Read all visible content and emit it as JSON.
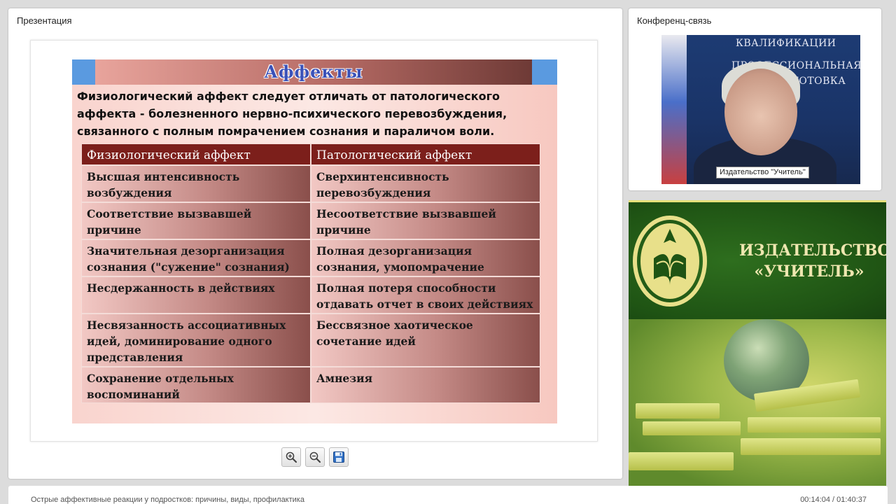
{
  "presentation": {
    "panel_title": "Презентация",
    "slide": {
      "title": "Аффекты",
      "intro": "Физиологический аффект следует отличать от патологического аффекта - болезненного нервно-психического перевозбуждения, связанного с полным помрачением сознания и параличом воли.",
      "table": {
        "headers": [
          "Физиологический аффект",
          "Патологический аффект"
        ],
        "rows": [
          [
            "Высшая интенсивность возбуждения",
            "Сверхинтенсивность перевозбуждения"
          ],
          [
            "Соответствие вызвавшей причине",
            "Несоответствие вызвавшей причине"
          ],
          [
            "Значительная дезорганизация сознания (\"сужение\" сознания)",
            "Полная дезорганизация сознания, умопомрачение"
          ],
          [
            "Несдержанность в действиях",
            "Полная потеря способности отдавать отчет в своих действиях"
          ],
          [
            "Несвязанность ассоциативных идей, доминирование одного представления",
            "Бессвязное хаотическое сочетание идей"
          ],
          [
            "Сохранение отдельных воспоминаний",
            "Амнезия"
          ]
        ]
      }
    },
    "controls": {
      "zoom_in_icon": "zoom-in-icon",
      "zoom_out_icon": "zoom-out-icon",
      "save_icon": "save-icon"
    }
  },
  "conference": {
    "panel_title": "Конференц-связь",
    "video_label": "Издательство \"Учитель\"",
    "background_texts": [
      "КВАЛИФИКАЦИИ",
      "ПРОФЕССИОНАЛЬНАЯ",
      "ПОДГОТОВКА"
    ]
  },
  "promo": {
    "line1": "ИЗДАТЕЛЬСТВО",
    "line2": "«УЧИТЕЛЬ»"
  },
  "footer": {
    "title": "Острые аффективные реакции у подростков: причины, виды, профилактика",
    "time": "00:14:04 / 01:40:37"
  },
  "colors": {
    "header_cell": "#7c1f1b",
    "title_bar_blue": "#5a9ae0",
    "title_text": "#3b52b8",
    "promo_green": "#1f5414",
    "promo_gold": "#efe7b0"
  }
}
